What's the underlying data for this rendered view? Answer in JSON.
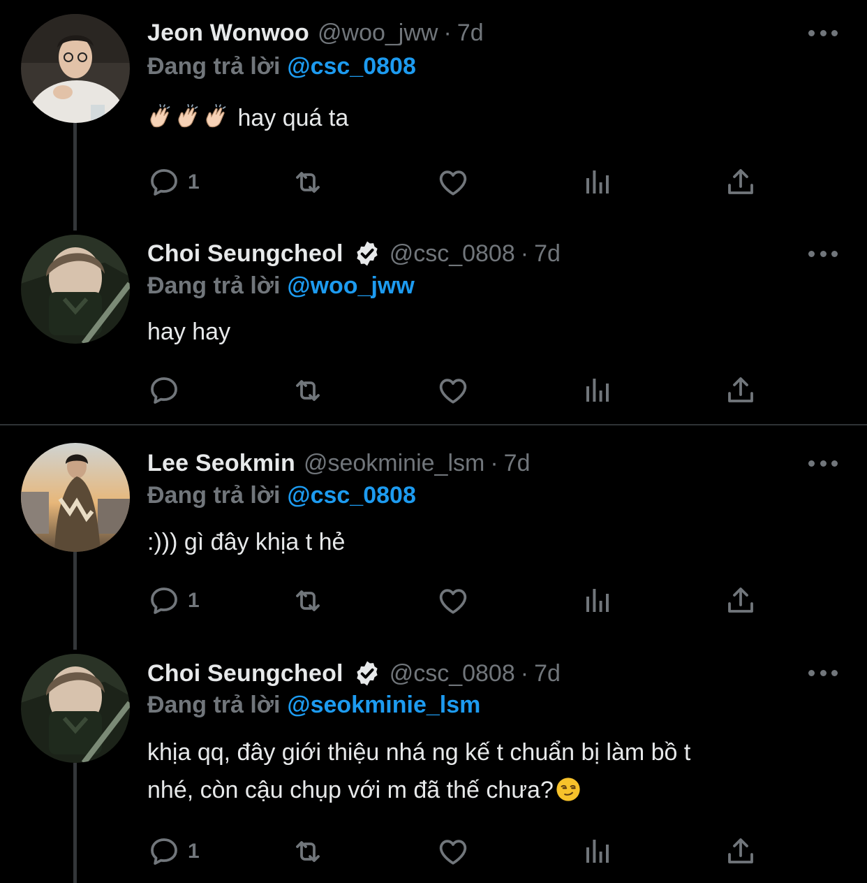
{
  "colors": {
    "background": "#000000",
    "text": "#e7e9ea",
    "muted": "#71767b",
    "link": "#1d9bf0",
    "divider": "#2f3336"
  },
  "tweets": [
    {
      "name": "Jeon Wonwoo",
      "verified": false,
      "handle": "@woo_jww",
      "separator": "·",
      "time": "7d",
      "reply_prefix": "Đang trả lời",
      "reply_to": "@csc_0808",
      "text": "hay quá ta",
      "emojis": [
        "clapping-hands-icon",
        "clapping-hands-icon",
        "clapping-hands-icon"
      ],
      "reply_count": "1",
      "avatar_icon": "avatar-wonwoo"
    },
    {
      "name": "Choi Seungcheol",
      "verified": true,
      "handle": "@csc_0808",
      "separator": "·",
      "time": "7d",
      "reply_prefix": "Đang trả lời",
      "reply_to": "@woo_jww",
      "text": "hay hay",
      "reply_count": "",
      "avatar_icon": "avatar-seungcheol"
    },
    {
      "name": "Lee Seokmin",
      "verified": false,
      "handle": "@seokminie_lsm",
      "separator": "·",
      "time": "7d",
      "reply_prefix": "Đang trả lời",
      "reply_to": "@csc_0808",
      "text": ":))) gì đây khịa t hẻ",
      "reply_count": "1",
      "avatar_icon": "avatar-seokmin"
    },
    {
      "name": "Choi Seungcheol",
      "verified": true,
      "handle": "@csc_0808",
      "separator": "·",
      "time": "7d",
      "reply_prefix": "Đang trả lời",
      "reply_to": "@seokminie_lsm",
      "text_line1": "khịa qq, đây giới thiệu nhá ng kế t chuẩn bị làm bồ t",
      "text_line2": "nhé, còn cậu chụp với m đã thế chưa?",
      "emoji": "smirking-face-icon",
      "reply_count": "1",
      "avatar_icon": "avatar-seungcheol"
    }
  ]
}
